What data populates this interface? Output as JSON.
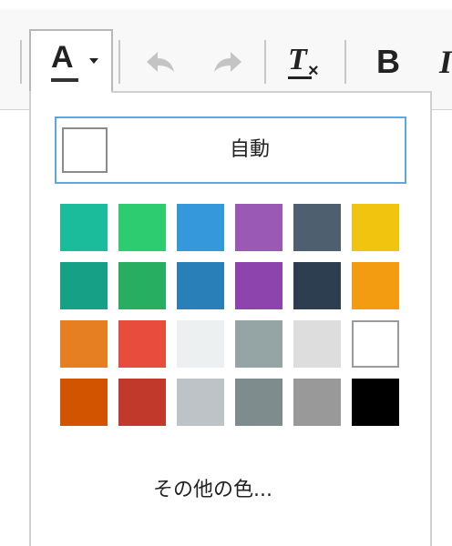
{
  "toolbar": {
    "font_color_glyph": "A",
    "clear_format_glyph": "T",
    "clear_format_x": "×",
    "bold_glyph": "B",
    "italic_glyph": "I"
  },
  "color_panel": {
    "auto_label": "自動",
    "more_colors_label": "その他の色...",
    "swatches": [
      "#1abc9c",
      "#2ecc71",
      "#3498db",
      "#9b59b6",
      "#4e5f70",
      "#f1c40f",
      "#16a085",
      "#27ae60",
      "#2980b9",
      "#8e44ad",
      "#2c3e50",
      "#f39c12",
      "#e67e22",
      "#e74c3c",
      "#ecf0f1",
      "#95a5a6",
      "#dddddd",
      "#ffffff",
      "#d35400",
      "#c0392b",
      "#bdc3c7",
      "#7f8c8d",
      "#999999",
      "#000000"
    ]
  }
}
